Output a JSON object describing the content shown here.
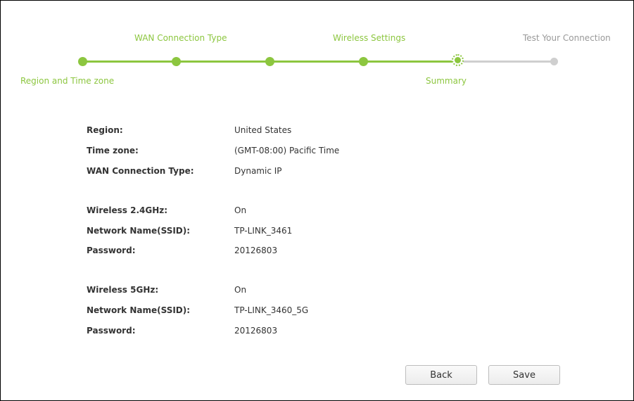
{
  "steps": {
    "top_labels": {
      "wan": "WAN Connection Type",
      "wireless": "Wireless Settings",
      "test": "Test Your Connection"
    },
    "bottom_labels": {
      "region": "Region and Time zone",
      "summary": "Summary"
    },
    "current_step": "Summary",
    "accent_color": "#8cc63f",
    "pending_color": "#cfcfcf"
  },
  "summary": {
    "region": {
      "label": "Region:",
      "value": "United States"
    },
    "timezone": {
      "label": "Time zone:",
      "value": "(GMT-08:00) Pacific Time"
    },
    "wan_type": {
      "label": "WAN Connection Type:",
      "value": "Dynamic IP"
    },
    "w24_enabled": {
      "label": "Wireless 2.4GHz:",
      "value": "On"
    },
    "w24_ssid": {
      "label": "Network Name(SSID):",
      "value": "TP-LINK_3461"
    },
    "w24_password": {
      "label": "Password:",
      "value": "20126803"
    },
    "w5_enabled": {
      "label": "Wireless 5GHz:",
      "value": "On"
    },
    "w5_ssid": {
      "label": "Network Name(SSID):",
      "value": "TP-LINK_3460_5G"
    },
    "w5_password": {
      "label": "Password:",
      "value": "20126803"
    }
  },
  "buttons": {
    "back": "Back",
    "save": "Save"
  }
}
